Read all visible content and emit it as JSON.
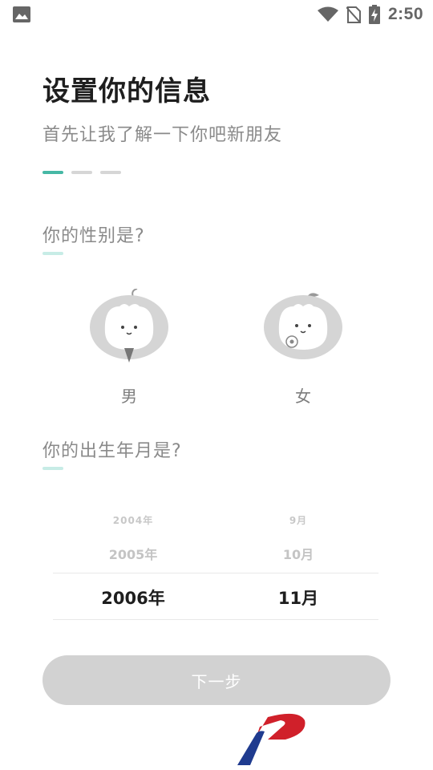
{
  "status_bar": {
    "time": "2:50",
    "icons": [
      "image-icon",
      "wifi-icon",
      "no-sim-icon",
      "battery-charging-icon"
    ]
  },
  "header": {
    "title": "设置你的信息",
    "subtitle": "首先让我了解一下你吧新朋友"
  },
  "progress": {
    "current_step": 1,
    "total_steps": 3,
    "active_color": "#46b8a5"
  },
  "gender_section": {
    "title": "你的性别是?",
    "options": [
      {
        "label": "男"
      },
      {
        "label": "女"
      }
    ]
  },
  "birth_section": {
    "title": "你的出生年月是?",
    "years": [
      "2004年",
      "2005年",
      "2006年"
    ],
    "months": [
      "9月",
      "10月",
      "11月"
    ],
    "selected_year": "2006年",
    "selected_month": "11月"
  },
  "next_button": {
    "label": "下一步",
    "enabled": false
  },
  "colors": {
    "accent": "#46b8a5",
    "accent_light": "#c7ece6",
    "button_disabled": "#d2d2d2"
  }
}
